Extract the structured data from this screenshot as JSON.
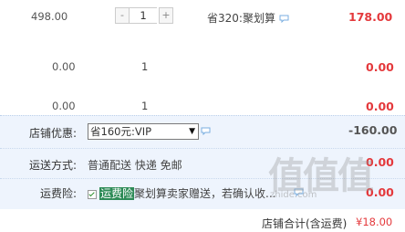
{
  "item1": {
    "price": "498.00",
    "qty_minus": "-",
    "qty_value": "1",
    "qty_plus": "+",
    "promo": "省320:聚划算",
    "subtotal": "178.00"
  },
  "item2": {
    "price": "0.00",
    "qty": "1",
    "subtotal": "0.00"
  },
  "item3": {
    "price": "0.00",
    "qty": "1",
    "subtotal": "0.00"
  },
  "shop_discount": {
    "label": "店铺优惠:",
    "selected": "省160元:VIP",
    "amount": "-160.00"
  },
  "shipping": {
    "label": "运送方式:",
    "value": "普通配送 快递 免邮",
    "amount": "0.00"
  },
  "insurance": {
    "label": "运费险:",
    "highlight": "运费险",
    "text": "聚划算卖家赠送，若确认收...",
    "amount": "0.00"
  },
  "total": {
    "label": "店铺合计(含运费)",
    "amount": "¥18.00"
  },
  "watermark": {
    "text": "值值值",
    "url": "zhide.com"
  },
  "colors": {
    "accent_red": "#e4393c",
    "shade_blue": "#eef4fd",
    "highlight_green": "#2e8b57"
  },
  "icons": [
    "speech-bubble-icon",
    "checkbox-checked",
    "dropdown-arrow-icon"
  ]
}
